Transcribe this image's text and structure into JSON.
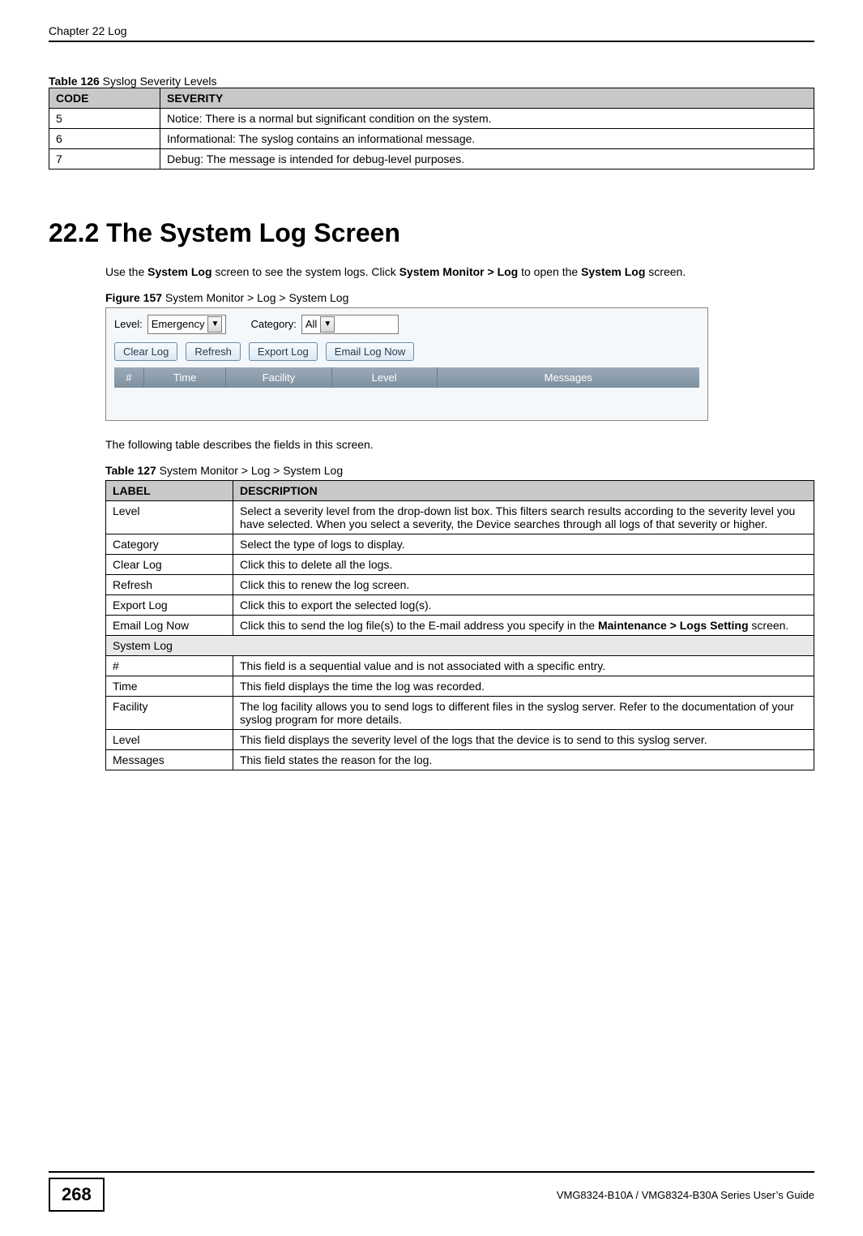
{
  "header": {
    "chapter": "Chapter 22 Log"
  },
  "table126": {
    "caption_bold": "Table 126",
    "caption_rest": "   Syslog Severity Levels",
    "head_code": "CODE",
    "head_sev": "SEVERITY",
    "rows": [
      {
        "code": "5",
        "sev": "Notice: There is a normal but significant condition on the system."
      },
      {
        "code": "6",
        "sev": "Informational: The syslog contains an informational message."
      },
      {
        "code": "7",
        "sev": "Debug: The message is intended for debug-level purposes."
      }
    ]
  },
  "section_heading": "22.2  The System Log Screen",
  "para1_a": "Use the ",
  "para1_b": "System Log",
  "para1_c": " screen to see the system logs. Click ",
  "para1_d": "System Monitor > Log",
  "para1_e": " to open the ",
  "para1_f": "System Log",
  "para1_g": " screen.",
  "fig157": {
    "caption_bold": "Figure 157",
    "caption_rest": "   System Monitor > Log > System Log"
  },
  "screenshot": {
    "level_label": "Level:",
    "level_value": "Emergency",
    "category_label": "Category:",
    "category_value": "All",
    "btn_clear": "Clear Log",
    "btn_refresh": "Refresh",
    "btn_export": "Export Log",
    "btn_email": "Email Log Now",
    "col_num": "#",
    "col_time": "Time",
    "col_fac": "Facility",
    "col_lvl": "Level",
    "col_msg": "Messages"
  },
  "para2": "The following table describes the fields in this screen.",
  "table127": {
    "caption_bold": "Table 127",
    "caption_rest": "   System Monitor > Log > System Log",
    "head_label": "LABEL",
    "head_desc": "DESCRIPTION",
    "rows": [
      {
        "label": "Level",
        "desc": "Select a severity level from the drop-down list box. This filters search results according to the severity level you have selected. When you select a severity, the Device searches through all logs of that severity or higher."
      },
      {
        "label": "Category",
        "desc": "Select the type of logs to display."
      },
      {
        "label": "Clear Log",
        "desc": "Click this to delete all the logs."
      },
      {
        "label": "Refresh",
        "desc": "Click this to renew the log screen."
      },
      {
        "label": "Export Log",
        "desc": "Click this to export the selected log(s)."
      }
    ],
    "email_row": {
      "label": "Email Log Now",
      "desc_a": "Click this to send the log file(s) to the E-mail address you specify in the ",
      "desc_b": "Maintenance > Logs Setting",
      "desc_c": " screen."
    },
    "section_row": "System Log",
    "rows2": [
      {
        "label": "#",
        "desc": "This field is a sequential value and is not associated with a specific entry."
      },
      {
        "label": "Time",
        "desc": "This field displays the time the log was recorded."
      },
      {
        "label": "Facility",
        "desc": "The log facility allows you to send logs to different files in the syslog server. Refer to the documentation of your syslog program for more details."
      },
      {
        "label": "Level",
        "desc": "This field displays the severity level of the logs that the device is to send to this syslog server."
      },
      {
        "label": "Messages",
        "desc": "This field states the reason for the log."
      }
    ]
  },
  "footer": {
    "page_number": "268",
    "guide": "VMG8324-B10A / VMG8324-B30A Series User’s Guide"
  }
}
